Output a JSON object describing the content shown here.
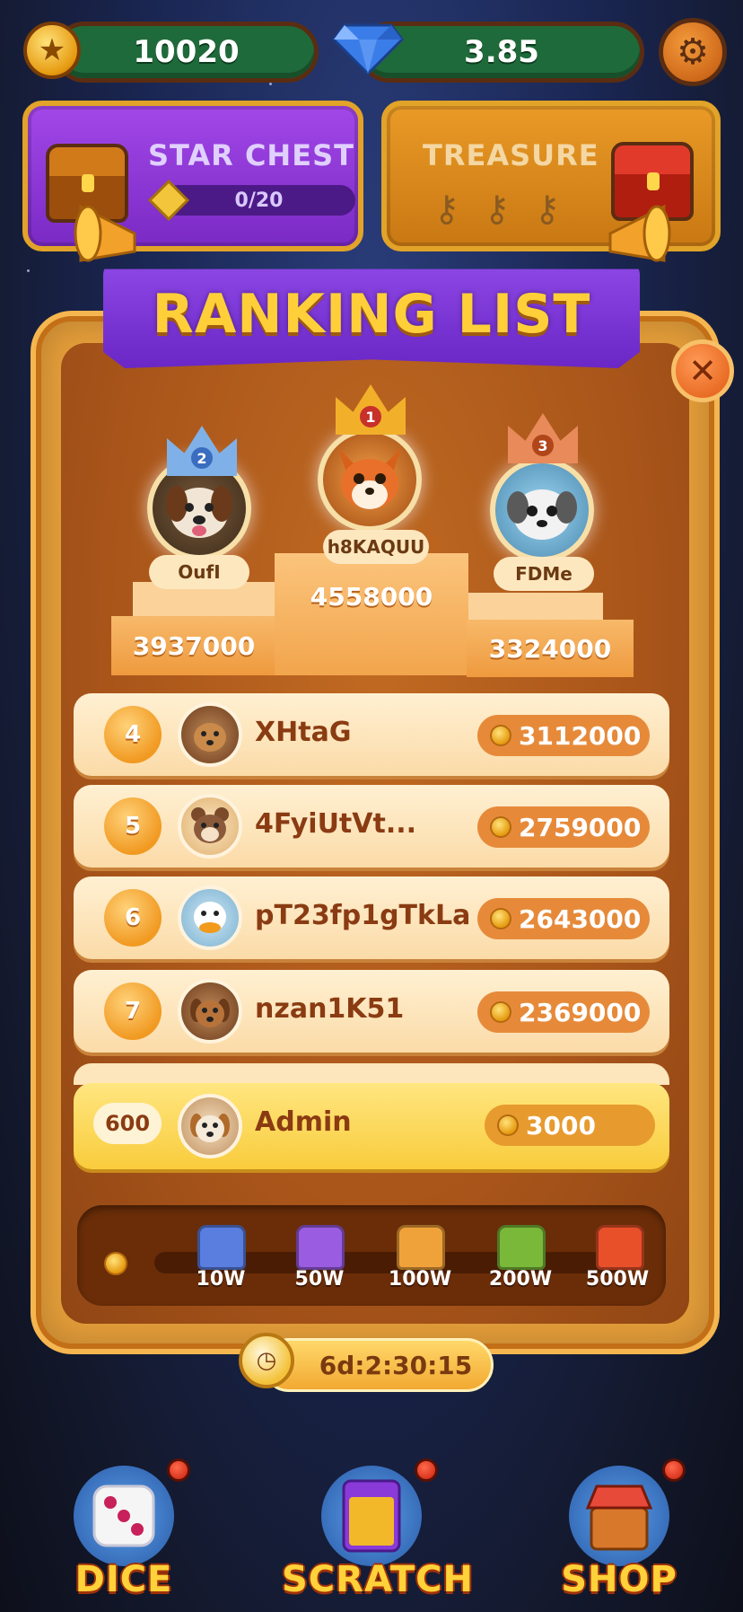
{
  "top_bar": {
    "coins": "10020",
    "gems": "3.85"
  },
  "star_chest": {
    "title": "STAR CHEST",
    "progress_text": "0/20"
  },
  "treasure": {
    "title": "TREASURE",
    "keys_shown": 3
  },
  "ranking": {
    "title": "RANKING LIST",
    "podium": [
      {
        "rank": "1",
        "name": "h8KAQUU",
        "score": "4558000",
        "crown_color": "#f2b02a"
      },
      {
        "rank": "2",
        "name": "OufI",
        "score": "3937000",
        "crown_color": "#7fb1e8"
      },
      {
        "rank": "3",
        "name": "FDMe",
        "score": "3324000",
        "crown_color": "#e88a5a"
      }
    ],
    "rows": [
      {
        "rank": "4",
        "name": "XHtaG",
        "score": "3112000"
      },
      {
        "rank": "5",
        "name": "4FyiUtVt...",
        "score": "2759000"
      },
      {
        "rank": "6",
        "name": "pT23fp1gTkLa",
        "score": "2643000"
      },
      {
        "rank": "7",
        "name": "nzan1K51",
        "score": "2369000"
      }
    ],
    "me": {
      "rank": "600",
      "name": "Admin",
      "score": "3000"
    }
  },
  "rewards": {
    "milestones": [
      {
        "label": "10W",
        "color": "#5a7de0"
      },
      {
        "label": "50W",
        "color": "#9a5ce0"
      },
      {
        "label": "100W",
        "color": "#f0a23a"
      },
      {
        "label": "200W",
        "color": "#7ab83a"
      },
      {
        "label": "500W",
        "color": "#e8502a"
      }
    ]
  },
  "timer": "6d:2:30:15",
  "nav": {
    "dice": "DICE",
    "scratch": "SCRATCH",
    "shop": "SHOP"
  },
  "icons": {
    "coin": "star-coin-icon",
    "gem": "diamond-icon",
    "settings": "gear-icon",
    "close": "close-icon",
    "timer": "stopwatch-icon"
  }
}
